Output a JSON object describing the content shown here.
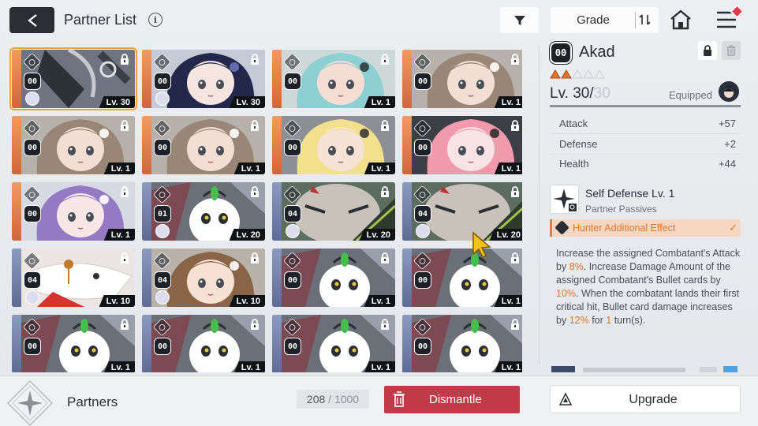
{
  "header": {
    "back_icon": "back-arrow-icon",
    "title": "Partner List",
    "info_icon": "info-icon",
    "filter_icon": "filter-icon",
    "sort_label": "Grade",
    "sort_icon": "sort-toggle-icon",
    "home_icon": "home-icon",
    "menu_icon": "hamburger-menu-icon"
  },
  "cards": [
    {
      "num": "00",
      "level": "Lv. 30",
      "role": "gear",
      "strip": "orange",
      "theme": "mecha",
      "selected": true,
      "avatar": true
    },
    {
      "num": "00",
      "level": "Lv. 30",
      "role": "shield",
      "strip": "orange",
      "theme": "navy-hair",
      "avatar": true
    },
    {
      "num": "00",
      "level": "Lv. 1",
      "role": "clock",
      "strip": "orange",
      "theme": "teal-hair"
    },
    {
      "num": "00",
      "level": "Lv. 1",
      "role": "swords",
      "strip": "orange",
      "theme": "brown-hair"
    },
    {
      "num": "00",
      "level": "Lv. 1",
      "role": "swords",
      "strip": "orange",
      "theme": "brown-hair"
    },
    {
      "num": "00",
      "level": "Lv. 1",
      "role": "swords",
      "strip": "orange",
      "theme": "brown-hair"
    },
    {
      "num": "00",
      "level": "Lv. 1",
      "role": "shield",
      "strip": "orange",
      "theme": "blonde-hair"
    },
    {
      "num": "00",
      "level": "Lv. 1",
      "role": "swords",
      "strip": "orange",
      "theme": "pink-hair"
    },
    {
      "num": "00",
      "level": "Lv. 1",
      "role": "swords",
      "strip": "orange",
      "theme": "purple-hair"
    },
    {
      "num": "01",
      "level": "Lv. 20",
      "role": "swords",
      "strip": "blue",
      "theme": "mascot",
      "avatar": true
    },
    {
      "num": "04",
      "level": "Lv. 20",
      "role": "swords",
      "strip": "blue",
      "theme": "beast",
      "avatar": true
    },
    {
      "num": "04",
      "level": "Lv. 20",
      "role": "swords",
      "strip": "blue",
      "theme": "beast",
      "avatar": true
    },
    {
      "num": "04",
      "level": "Lv. 10",
      "role": "bolt",
      "strip": "blue",
      "theme": "wolf",
      "avatar": true
    },
    {
      "num": "04",
      "level": "Lv. 10",
      "role": "gear",
      "strip": "blue",
      "theme": "brown-girl",
      "avatar": true
    },
    {
      "num": "00",
      "level": "Lv. 1",
      "role": "swords",
      "strip": "blue",
      "theme": "mascot"
    },
    {
      "num": "00",
      "level": "Lv. 1",
      "role": "swords",
      "strip": "blue",
      "theme": "mascot"
    },
    {
      "num": "00",
      "level": "Lv. 1",
      "role": "swords",
      "strip": "blue",
      "theme": "mascot"
    },
    {
      "num": "00",
      "level": "Lv. 1",
      "role": "swords",
      "strip": "blue",
      "theme": "mascot"
    },
    {
      "num": "00",
      "level": "Lv. 1",
      "role": "swords",
      "strip": "blue",
      "theme": "mascot"
    },
    {
      "num": "00",
      "level": "Lv. 1",
      "role": "swords",
      "strip": "blue",
      "theme": "mascot"
    }
  ],
  "detail": {
    "badge": "00",
    "name": "Akad",
    "stars_filled": 2,
    "stars_total": 5,
    "level_current": "Lv. 30/",
    "level_max": "30",
    "level_progress": 1.0,
    "equipped_label": "Equipped",
    "stats": [
      {
        "label": "Attack",
        "value": "+57"
      },
      {
        "label": "Defense",
        "value": "+2"
      },
      {
        "label": "Health",
        "value": "+44"
      }
    ],
    "skill_name": "Self Defense Lv. 1",
    "skill_sub": "Partner Passives",
    "effect_label": "Hunter Additional Effect",
    "description": [
      {
        "t": "Increase the assigned Combatant's Attack by "
      },
      {
        "t": "8%",
        "hl": true
      },
      {
        "t": ". Increase Damage Amount of the assigned Combatant's Bullet cards by "
      },
      {
        "t": "10%",
        "hl": true
      },
      {
        "t": ". When the combatant lands their first critical hit, Bullet card damage increases by "
      },
      {
        "t": "12%",
        "hl": true
      },
      {
        "t": " for "
      },
      {
        "t": "1",
        "hl": true
      },
      {
        "t": " turn(s)."
      }
    ]
  },
  "footer": {
    "partners_label": "Partners",
    "count_current": "208",
    "count_sep": " / ",
    "count_total": "1000",
    "dismantle_label": "Dismantle",
    "upgrade_label": "Upgrade"
  },
  "colors": {
    "accent_orange": "#e0742a",
    "dismantle_red": "#c03a4a",
    "dark": "#2b2e34",
    "selected_outline": "#f0a530"
  }
}
